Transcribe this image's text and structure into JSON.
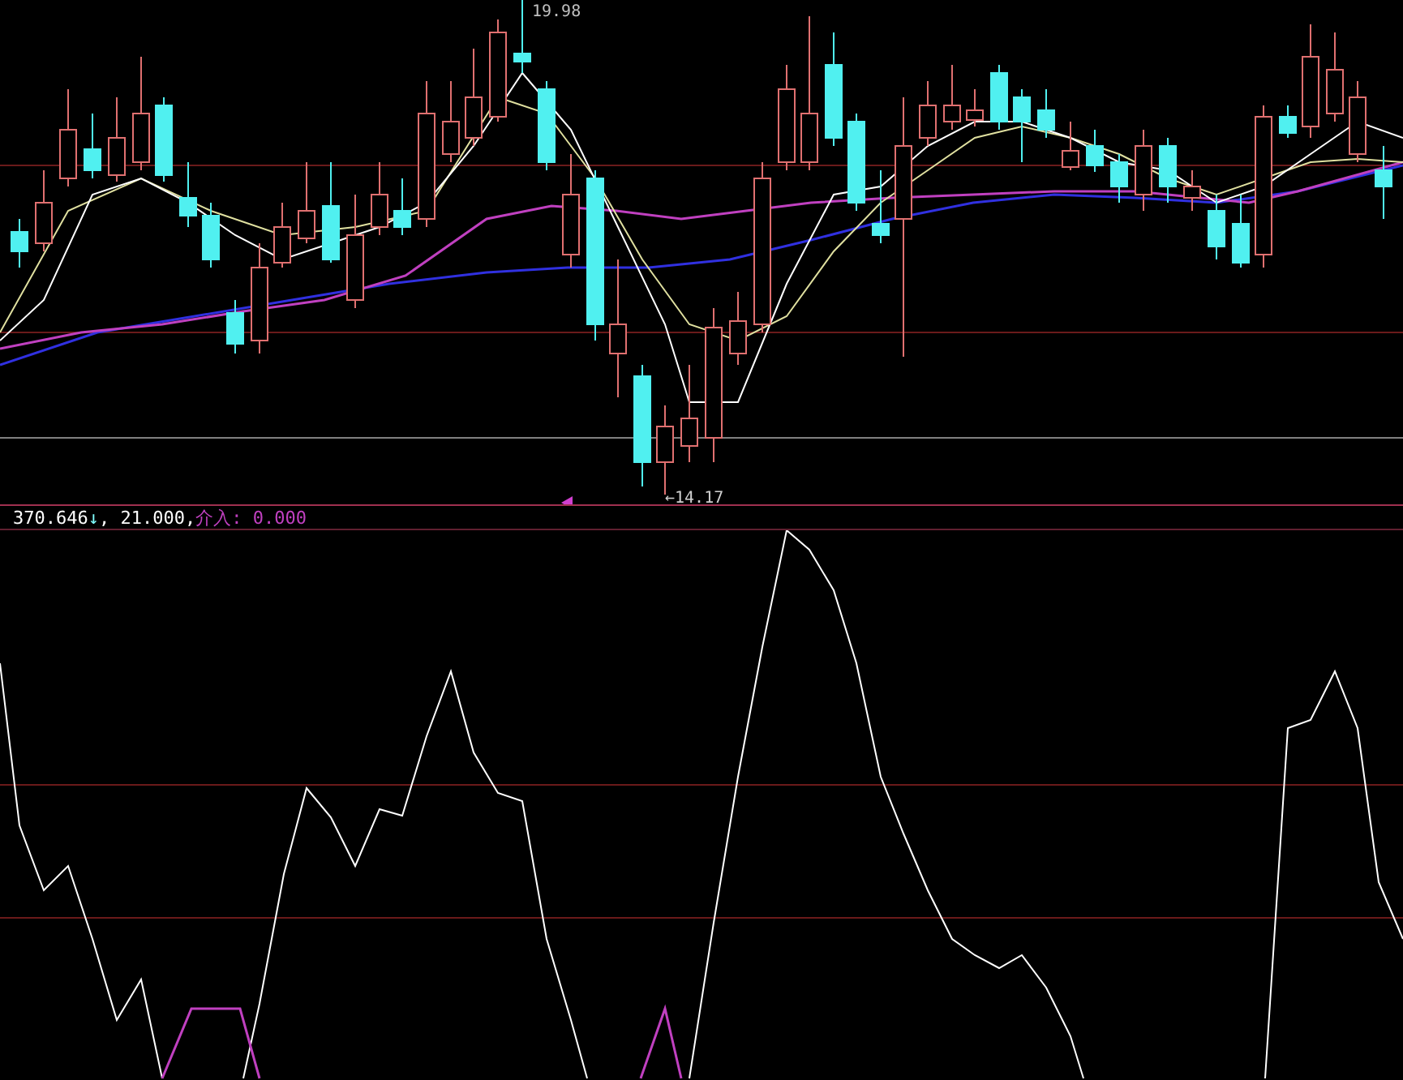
{
  "price_panel": {
    "high_label": "19.98",
    "low_label": "14.17",
    "low_arrow": "←"
  },
  "readout": [
    {
      "text": "370.646",
      "kind": "value"
    },
    {
      "text": "↓",
      "kind": "trend"
    },
    {
      "text": ", 21.000,",
      "kind": "value"
    },
    {
      "text": "介入: 0.000",
      "kind": "signal"
    }
  ]
}
